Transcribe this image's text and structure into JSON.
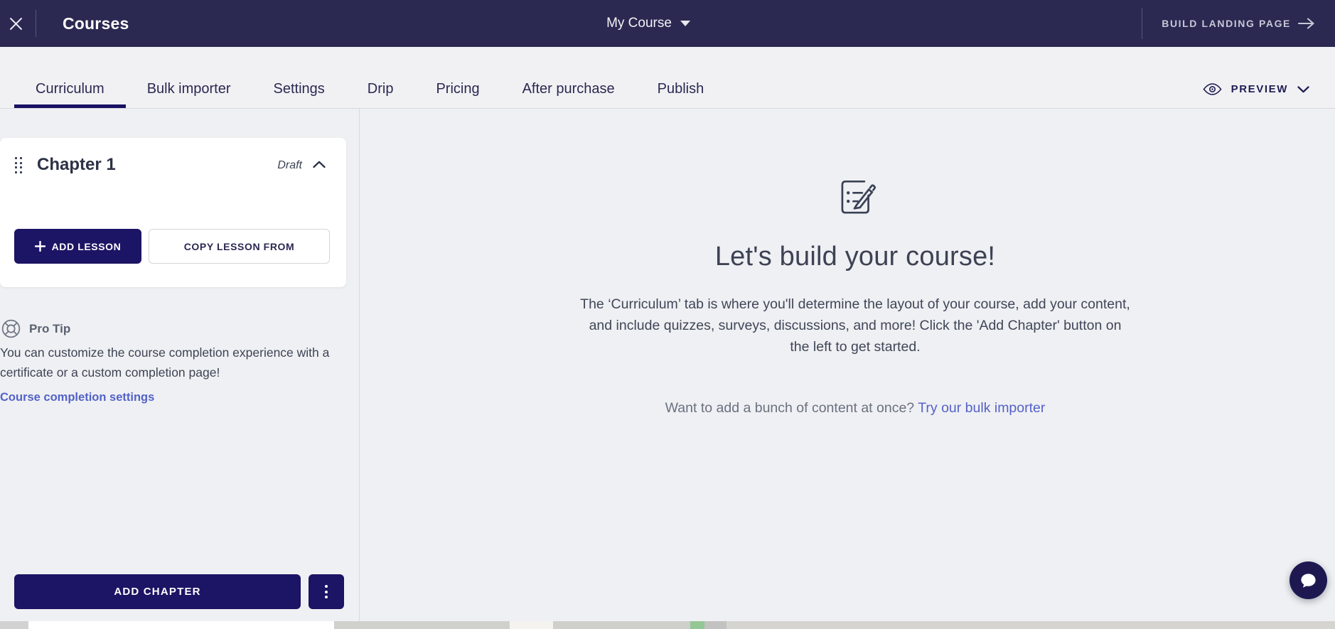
{
  "header": {
    "title": "Courses",
    "course_selector": {
      "label": "My Course"
    },
    "build_landing": {
      "label": "BUILD LANDING PAGE"
    }
  },
  "tabs": {
    "items": [
      "Curriculum",
      "Bulk importer",
      "Settings",
      "Drip",
      "Pricing",
      "After purchase",
      "Publish"
    ],
    "active": "Curriculum",
    "preview": {
      "label": "PREVIEW"
    }
  },
  "sidebar": {
    "chapter": {
      "title": "Chapter 1",
      "status": "Draft",
      "add_lesson_label": "ADD LESSON",
      "copy_lesson_label": "COPY LESSON FROM"
    },
    "pro_tip": {
      "label": "Pro Tip",
      "body": "You can customize the course completion experience with a certificate or a custom completion page!",
      "link_label": "Course completion settings"
    },
    "add_chapter_label": "ADD CHAPTER"
  },
  "main": {
    "heading": "Let's build your course!",
    "description": "The ‘Curriculum’ tab is where you'll determine the layout of your course, add your content, and include quizzes, surveys, discussions, and more! Click the 'Add Chapter' button on the left to get started.",
    "bulk_prompt": "Want to add a bunch of content at once? ",
    "bulk_link_label": "Try our bulk importer"
  },
  "icons": {
    "close": "x",
    "course_caret": "caret-down",
    "build_arrow": "arrow-right",
    "preview_eye": "eye",
    "preview_caret": "chevron-down",
    "chapter_drag": "drag-handle",
    "chapter_collapse": "chevron-up",
    "add": "plus",
    "pro_tip": "lifebuoy",
    "empty_state": "notes-and-pencil",
    "chapter_menu": "kebab",
    "chat": "chat-bubble"
  },
  "colors": {
    "header_bg": "#2b2851",
    "primary_button": "#1c1464",
    "active_tab_underline": "#191162",
    "link": "#5362c8",
    "tab_text": "#2b2851",
    "page_bg": "#eff0f3",
    "green_strip_segment": "#93c793"
  }
}
